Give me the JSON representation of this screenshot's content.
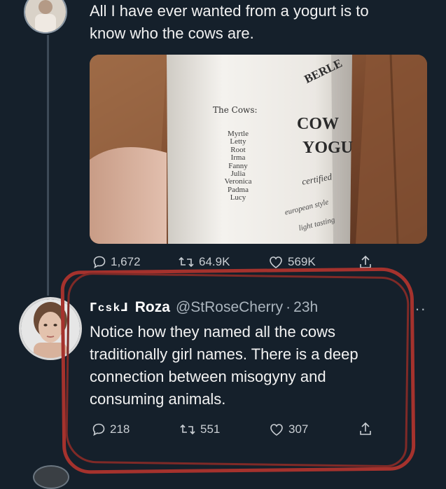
{
  "tweet": {
    "text_line1": "All I have ever wanted from a yogurt is to",
    "text_line2": "know who the cows are.",
    "stats": {
      "replies": "1,672",
      "retweets": "64.9K",
      "likes": "569K"
    },
    "image": {
      "label_heading": "The Cows:",
      "cow_names": [
        "Myrtle",
        "Letty",
        "Root",
        "Irma",
        "Fanny",
        "Julia",
        "Veronica",
        "Padma",
        "Lucy"
      ],
      "brand_partial": "BERLE",
      "product_line1": "COW",
      "product_line2": "YOGU",
      "certified": "certified",
      "desc_line1": "european style",
      "desc_line2": "light tasting"
    }
  },
  "reply": {
    "tag": "ᒥcskᒧ",
    "name": "Roza",
    "handle": "@StRoseCherry",
    "separator": "·",
    "time": "23h",
    "more": "···",
    "lines": [
      "Notice how they named all the cows",
      "traditionally girl names. There is a deep",
      "connection between misogyny and",
      "consuming animals."
    ],
    "stats": {
      "replies": "218",
      "retweets": "551",
      "likes": "307"
    }
  },
  "colors": {
    "background": "#15202b",
    "annotation_circle": "#a5322d",
    "text": "#e7e9ea",
    "muted": "#aab4bd"
  }
}
